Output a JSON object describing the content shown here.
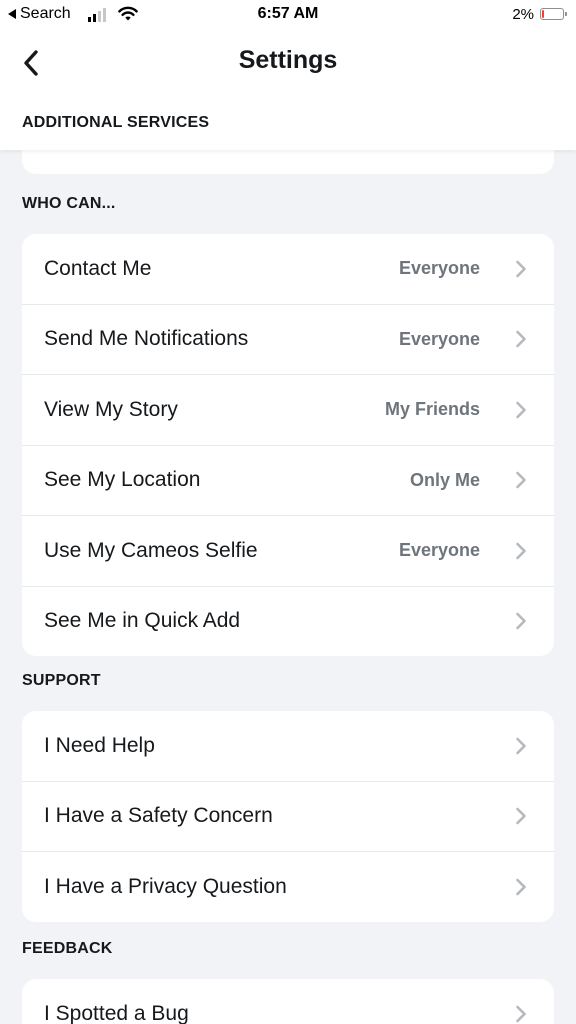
{
  "status_bar": {
    "back_app": "Search",
    "time": "6:57 AM",
    "battery": "2%"
  },
  "header": {
    "title": "Settings",
    "section": "ADDITIONAL SERVICES"
  },
  "sections": {
    "who_can": {
      "title": "WHO CAN...",
      "rows": [
        {
          "label": "Contact Me",
          "value": "Everyone"
        },
        {
          "label": "Send Me Notifications",
          "value": "Everyone"
        },
        {
          "label": "View My Story",
          "value": "My Friends"
        },
        {
          "label": "See My Location",
          "value": "Only Me"
        },
        {
          "label": "Use My Cameos Selfie",
          "value": "Everyone"
        },
        {
          "label": "See Me in Quick Add",
          "value": ""
        }
      ]
    },
    "support": {
      "title": "SUPPORT",
      "rows": [
        {
          "label": "I Need Help"
        },
        {
          "label": "I Have a Safety Concern"
        },
        {
          "label": "I Have a Privacy Question"
        }
      ]
    },
    "feedback": {
      "title": "FEEDBACK",
      "rows": [
        {
          "label": "I Spotted a Bug"
        }
      ]
    }
  },
  "icons": {
    "back": "chevron-left-icon",
    "row_arrow": "chevron-right-icon",
    "signal": "cellular-signal-icon",
    "wifi": "wifi-icon",
    "battery": "battery-icon"
  },
  "colors": {
    "background": "#f2f3f6",
    "card": "#ffffff",
    "value_text": "#6f757c",
    "chevron": "#b5b8bd",
    "battery_low": "#ff3b30"
  }
}
